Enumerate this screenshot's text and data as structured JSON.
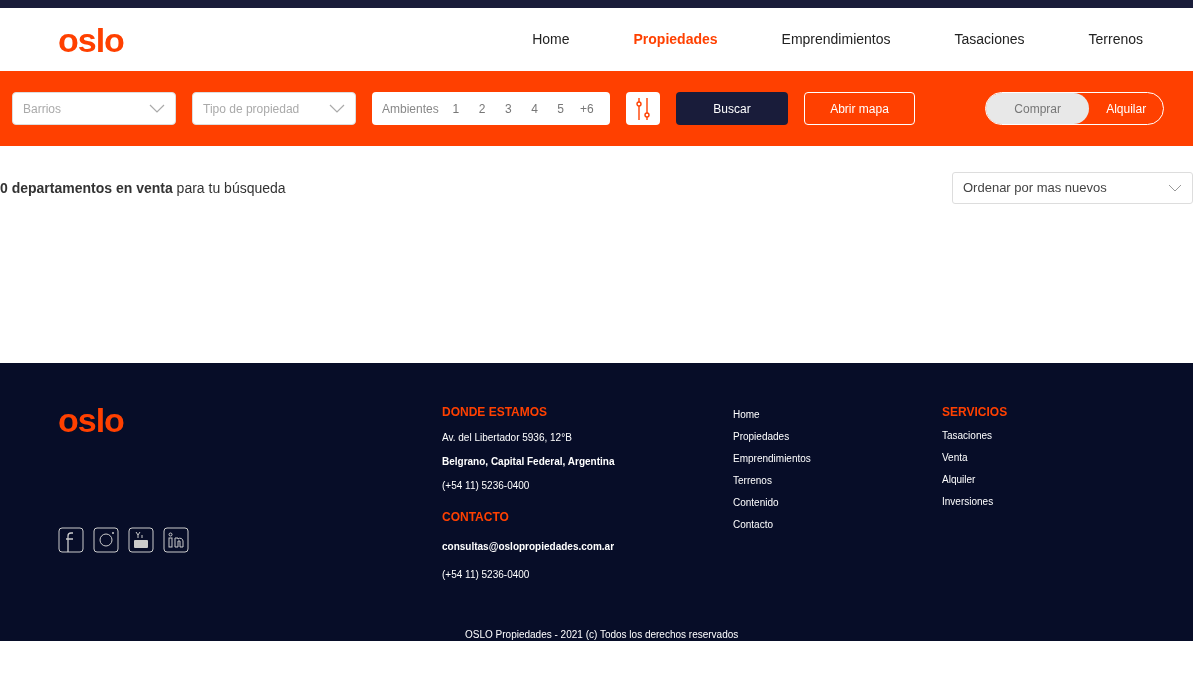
{
  "header": {
    "logo": "oslo",
    "nav": [
      {
        "label": "Home",
        "selected": false
      },
      {
        "label": "Propiedades",
        "selected": true
      },
      {
        "label": "Emprendimientos",
        "selected": false
      },
      {
        "label": "Tasaciones",
        "selected": false
      },
      {
        "label": "Terrenos",
        "selected": false
      }
    ]
  },
  "filters": {
    "neighborhoods": {
      "placeholder": "Barrios"
    },
    "property_type": {
      "placeholder": "Tipo de propiedad"
    },
    "rooms": {
      "label": "Ambientes",
      "options": [
        "1",
        "2",
        "3",
        "4",
        "5",
        "+6"
      ]
    },
    "search_button": "Buscar",
    "map_button": "Abrir mapa",
    "operation": [
      {
        "label": "Comprar",
        "selected": true
      },
      {
        "label": "Alquilar",
        "selected": false
      }
    ]
  },
  "results": {
    "summary": "**0 departamentos en venta** para tu búsqueda",
    "sort": "Ordenar por mas nuevos"
  },
  "footer": {
    "logo": "oslo",
    "location": {
      "title": "DONDE ESTAMOS",
      "lines": [
        {
          "text": "Av. del Libertador 5936, 12°B",
          "bold": false
        },
        {
          "text": "Belgrano, Capital Federal, Argentina",
          "bold": true
        },
        {
          "text": "(+54 11) 5236-0400",
          "bold": false
        }
      ]
    },
    "contact": {
      "title": "CONTACTO",
      "lines": [
        {
          "text": "consultas@oslopropiedades.com.ar",
          "bold": true
        },
        {
          "text": "(+54 11) 5236-0400",
          "bold": false
        }
      ]
    },
    "links": [
      "Home",
      "Propiedades",
      "Emprendimientos",
      "Terrenos",
      "Contenido",
      "Contacto"
    ],
    "services": {
      "title": "SERVICIOS",
      "items": [
        "Tasaciones",
        "Venta",
        "Alquiler",
        "Inversiones"
      ]
    },
    "copyright": "OSLO Propiedades - 2021 (c) Todos los derechos reservados"
  }
}
